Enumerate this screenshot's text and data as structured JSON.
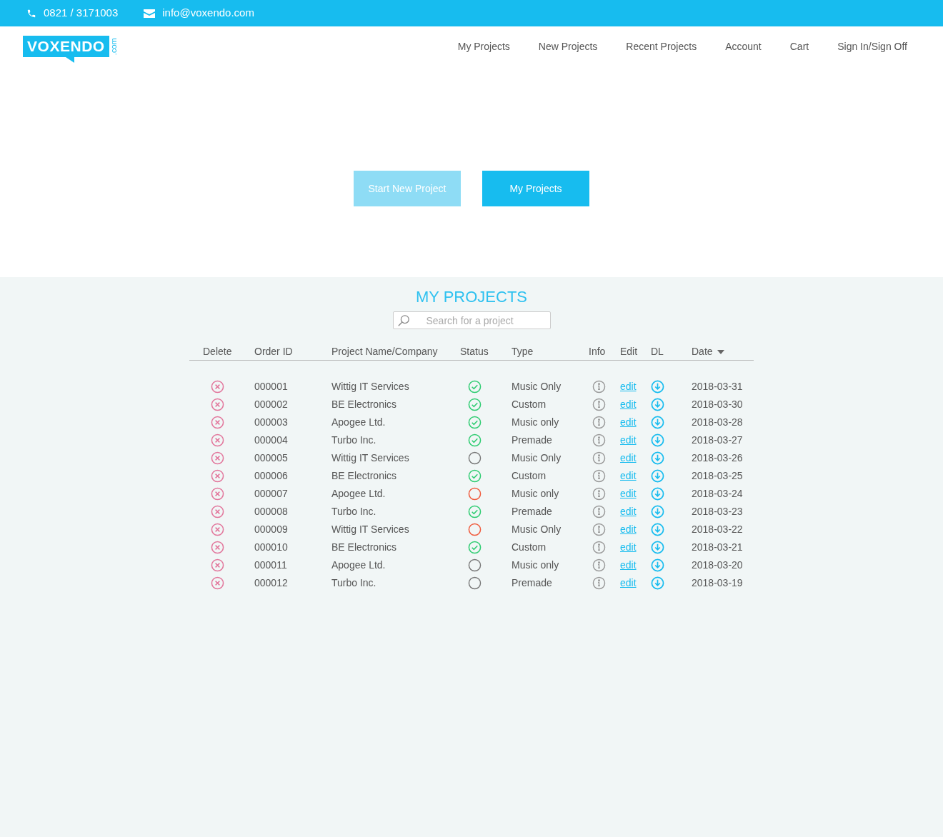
{
  "topbar": {
    "phone": "0821 / 3171003",
    "email": "info@voxendo.com"
  },
  "logo": {
    "name": "VOXENDO",
    "suffix": ".com"
  },
  "nav": [
    "My Projects",
    "New Projects",
    "Recent Projects",
    "Account",
    "Cart",
    "Sign In/Sign Off"
  ],
  "hero_buttons": [
    {
      "label": "Start New Project",
      "disabled": true
    },
    {
      "label": "My Projects",
      "disabled": false
    }
  ],
  "section_title": "MY PROJECTS",
  "search": {
    "placeholder": "Search for a project"
  },
  "table": {
    "columns": [
      "Delete",
      "Order ID",
      "Project Name/Company",
      "Status",
      "Type",
      "Info",
      "Edit",
      "DL",
      "Date"
    ],
    "rows": [
      {
        "order_id": "000001",
        "name": "Wittig IT Services",
        "kind": "done",
        "type": "Music Only",
        "edit": "edit",
        "date": "2018-03-31"
      },
      {
        "order_id": "000002",
        "name": "BE Electronics",
        "kind": "done",
        "type": "Custom",
        "edit": "edit",
        "date": "2018-03-30"
      },
      {
        "order_id": "000003",
        "name": "Apogee Ltd.",
        "kind": "done",
        "type": "Music only",
        "edit": "edit",
        "date": "2018-03-28"
      },
      {
        "order_id": "000004",
        "name": "Turbo Inc.",
        "kind": "done",
        "type": "Premade",
        "edit": "edit",
        "date": "2018-03-27"
      },
      {
        "order_id": "000005",
        "name": "Wittig IT Services",
        "kind": "pending",
        "type": "Music Only",
        "edit": "edit",
        "date": "2018-03-26"
      },
      {
        "order_id": "000006",
        "name": "BE Electronics",
        "kind": "done",
        "type": "Custom",
        "edit": "edit",
        "date": "2018-03-25"
      },
      {
        "order_id": "000007",
        "name": "Apogee Ltd.",
        "kind": "failed",
        "type": "Music only",
        "edit": "edit",
        "date": "2018-03-24"
      },
      {
        "order_id": "000008",
        "name": "Turbo Inc.",
        "kind": "done",
        "type": "Premade",
        "edit": "edit",
        "date": "2018-03-23"
      },
      {
        "order_id": "000009",
        "name": "Wittig IT Services",
        "kind": "failed",
        "type": "Music Only",
        "edit": "edit",
        "date": "2018-03-22"
      },
      {
        "order_id": "000010",
        "name": "BE Electronics",
        "kind": "done",
        "type": "Custom",
        "edit": "edit",
        "date": "2018-03-21"
      },
      {
        "order_id": "000011",
        "name": "Apogee Ltd.",
        "kind": "pending",
        "type": "Music only",
        "edit": "edit",
        "date": "2018-03-20"
      },
      {
        "order_id": "000012",
        "name": "Turbo Inc.",
        "kind": "pending",
        "type": "Premade",
        "edit": "edit",
        "date": "2018-03-19"
      }
    ]
  }
}
